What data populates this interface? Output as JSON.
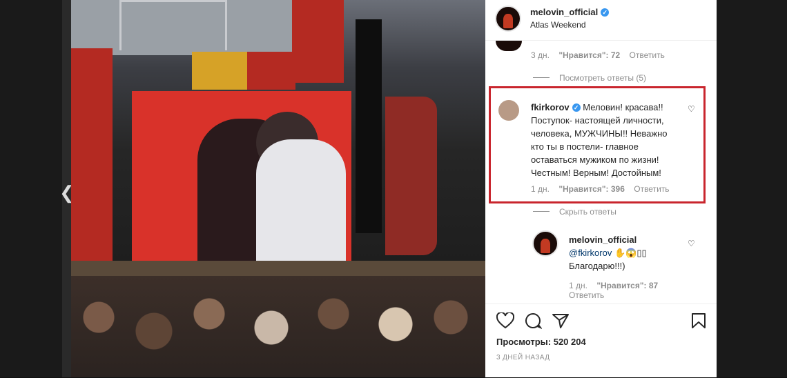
{
  "media": {
    "prev_arrow": "❮"
  },
  "post": {
    "author": "melovin_official",
    "location": "Atlas Weekend",
    "verified_glyph": "✓"
  },
  "top_comment": {
    "time": "3 дн.",
    "likes": "\"Нравится\": 72",
    "reply": "Ответить",
    "view_replies": "Посмотреть ответы (5)"
  },
  "highlighted_comment": {
    "author": "fkirkorov",
    "text": "Меловин! красава!! Поступок- настоящей личности, человека, МУЖЧИНЫ!! Неважно кто ты в постели- главное оставаться мужиком по жизни! Честным! Верным! Достойным!",
    "time": "1 дн.",
    "likes": "\"Нравится\": 396",
    "reply": "Ответить",
    "hide_replies": "Скрыть ответы",
    "highlight_color": "#c9252d"
  },
  "reply_comment": {
    "author": "melovin_official",
    "mention": "@fkirkorov",
    "emojis": "✋😱▯▯",
    "text": "Благодарю!!!)",
    "time": "1 дн.",
    "likes": "\"Нравится\": 87",
    "reply": "Ответить"
  },
  "actions": {
    "like_icon": "heart-icon",
    "comment_icon": "comment-icon",
    "share_icon": "share-icon",
    "save_icon": "bookmark-icon",
    "views_label": "Просмотры:",
    "views_count": "520 204",
    "time_ago": "3 ДНЕЙ НАЗАД"
  },
  "colors": {
    "verified": "#3897f0",
    "highlight": "#c9252d",
    "secondary_text": "#8e8e8e"
  }
}
